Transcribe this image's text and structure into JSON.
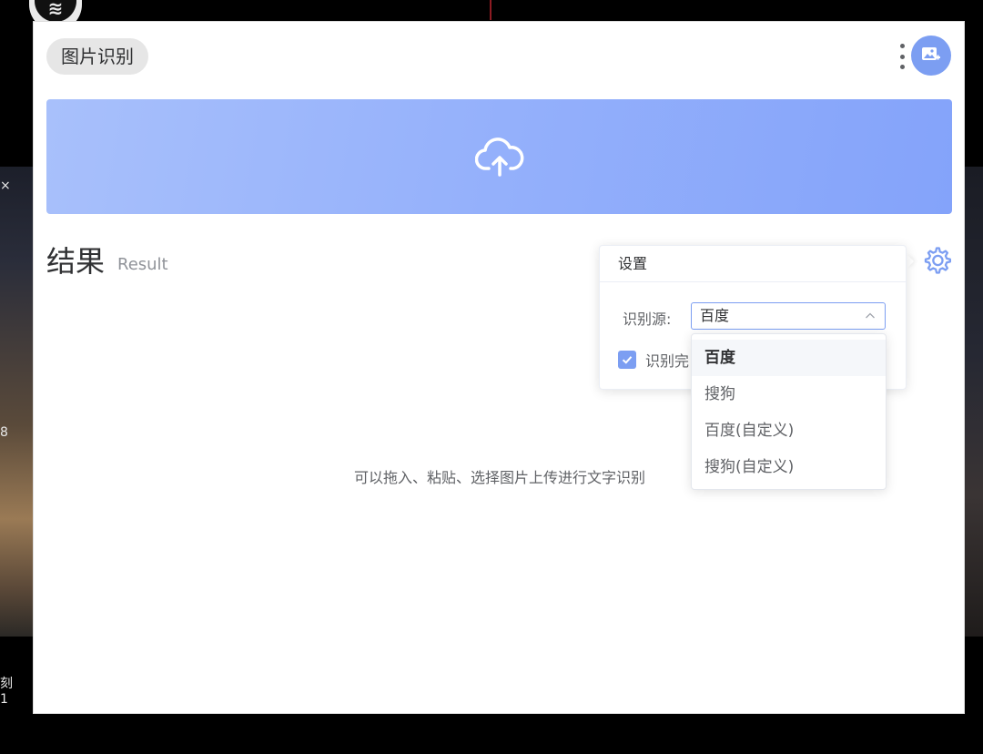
{
  "desktop": {
    "side_text_x": "×",
    "side_text_8": "8",
    "side_text_ke": "刻",
    "side_text_1": "1"
  },
  "app": {
    "title": "图片识别",
    "accent_color": "#7c9ef2"
  },
  "result": {
    "title": "结果",
    "subtitle": "Result",
    "hint": "可以拖入、粘贴、选择图片上传进行文字识别"
  },
  "settings": {
    "title": "设置",
    "source_label": "识别源:",
    "source_value": "百度",
    "checkbox_label": "识别完",
    "checkbox_checked": true
  },
  "dropdown": {
    "options": [
      "百度",
      "搜狗",
      "百度(自定义)",
      "搜狗(自定义)"
    ],
    "selected_index": 0
  }
}
